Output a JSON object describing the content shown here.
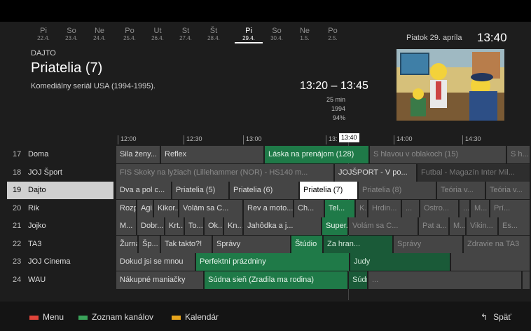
{
  "days": [
    {
      "name": "Pi",
      "date": "22.4."
    },
    {
      "name": "So",
      "date": "23.4."
    },
    {
      "name": "Ne",
      "date": "24.4."
    },
    {
      "name": "Po",
      "date": "25.4."
    },
    {
      "name": "Ut",
      "date": "26.4."
    },
    {
      "name": "St",
      "date": "27.4."
    },
    {
      "name": "Št",
      "date": "28.4."
    },
    {
      "name": "Pi",
      "date": "29.4."
    },
    {
      "name": "So",
      "date": "30.4."
    },
    {
      "name": "Ne",
      "date": "1.5."
    },
    {
      "name": "Po",
      "date": "2.5."
    }
  ],
  "selected_day_index": 7,
  "header": {
    "date_label": "Piatok 29. apríla",
    "clock": "13:40"
  },
  "program": {
    "channel": "DAJTO",
    "title": "Priatelia (7)",
    "description": "Komediálny seriál USA (1994-1995).",
    "time": "13:20 – 13:45",
    "duration": "25 min",
    "year": "1994",
    "progress_label": "94%"
  },
  "timeline": {
    "ticks": [
      "12:00",
      "12:30",
      "13:00",
      "13:",
      "14:00",
      "14:30"
    ],
    "now": "13:40"
  },
  "channels": [
    {
      "num": "17",
      "name": "Doma"
    },
    {
      "num": "18",
      "name": "JOJ Šport"
    },
    {
      "num": "19",
      "name": "Dajto"
    },
    {
      "num": "20",
      "name": "Rik"
    },
    {
      "num": "21",
      "name": "Jojko"
    },
    {
      "num": "22",
      "name": "TA3"
    },
    {
      "num": "23",
      "name": "JOJ Cinema"
    },
    {
      "num": "24",
      "name": "WAU"
    }
  ],
  "programs": [
    [
      "Sila ženy...",
      "Reflex",
      "Láska na prenájom (128)",
      "S hlavou v oblakoch (15)",
      "S h..."
    ],
    [
      "FIS Skoky na lyžiach (Lillehammer (NOR) - HS140 m...",
      "JOJŠPORT - V po...",
      "Futbal - Magazín Inter Mil..."
    ],
    [
      "Dva a pol c...",
      "Priatelia (5)",
      "Priatelia (6)",
      "Priatelia (7)",
      "Priatelia (8)",
      "Teória v...",
      "Teória v..."
    ],
    [
      "Rozpr...",
      "Agi...",
      "Kikor...",
      "Volám sa C...",
      "Rev a moto...",
      "Ch...",
      "Tel...",
      "K...",
      "Hrdin...",
      "...",
      "Ostro...",
      "...",
      "M...",
      "Prí..."
    ],
    [
      "M...",
      "Dobr...",
      "Krt...",
      "To...",
      "Ok...",
      "Kn...",
      "Jahôdka a j...",
      "Super...",
      "Volám sa C...",
      "Pat a...",
      "M...",
      "Vikin...",
      "Es..."
    ],
    [
      "Žurnál",
      "Šp...",
      "Tak takto?!",
      "Správy",
      "Štúdio",
      "Za hran...",
      "Správy",
      "Zdravie na TA3"
    ],
    [
      "Dokud jsi se mnou",
      "Perfektní prázdniny",
      "Judy"
    ],
    [
      "Nákupné maniačky",
      "Súdna sieň (Zradila ma rodina)",
      "Súdna sieň (S bratom sa nedohod...",
      "..."
    ]
  ],
  "footer": {
    "menu": "Menu",
    "channels": "Zoznam kanálov",
    "calendar": "Kalendár",
    "back": "Späť",
    "colors": {
      "red": "#e0443a",
      "green": "#3aa35a",
      "yellow": "#e7a51c"
    }
  }
}
